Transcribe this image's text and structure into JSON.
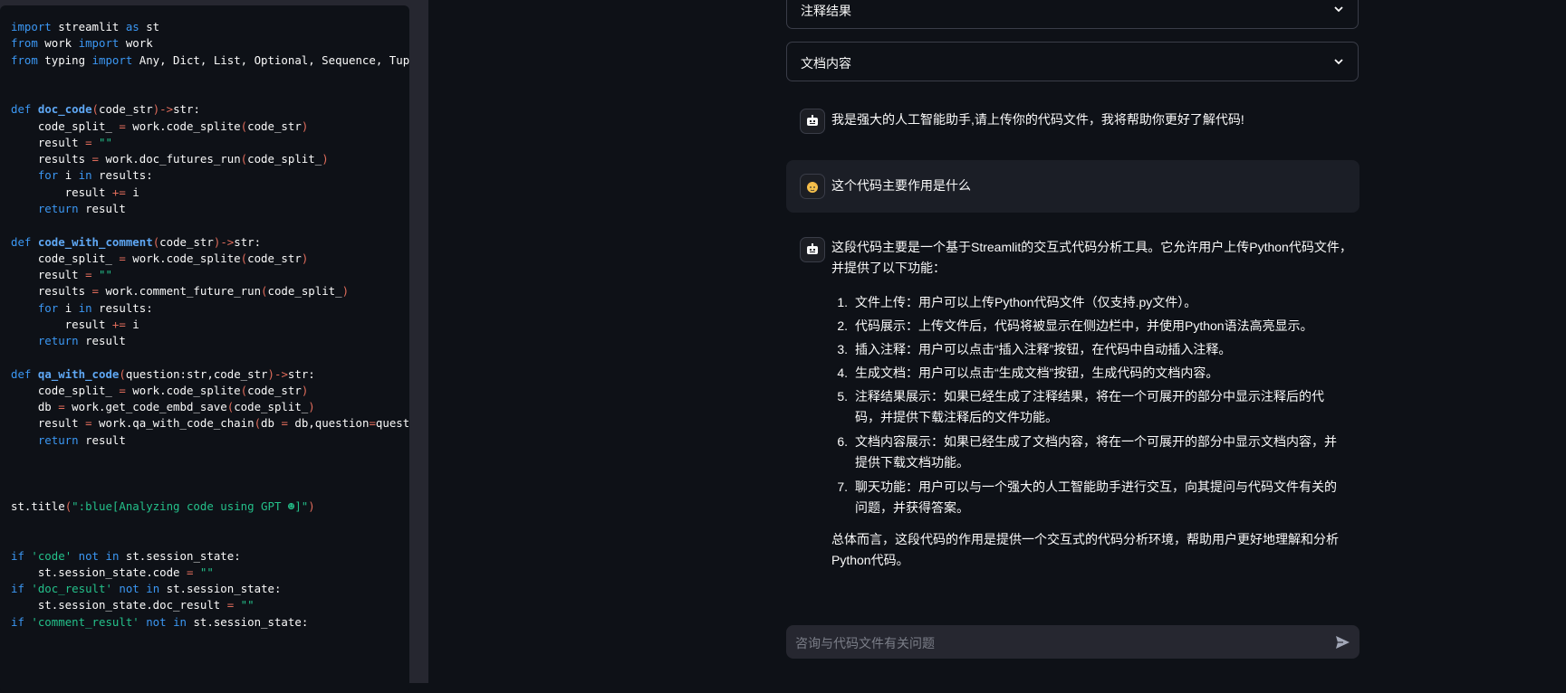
{
  "colors": {
    "app_bg": "#0e1117",
    "sidebar_bg": "#262730",
    "keyword": "#3b97f3",
    "string": "#24c08a",
    "operator": "#e06c5b",
    "border": "#3a3d48"
  },
  "sidebar": {
    "code": {
      "language": "python",
      "lines": [
        "import streamlit as st",
        "from work import work",
        "from typing import Any, Dict, List, Optional, Sequence, Tup",
        "",
        "",
        "def doc_code(code_str)->str:",
        "    code_split_ = work.code_splite(code_str)",
        "    result = \"\"",
        "    results = work.doc_futures_run(code_split_)",
        "    for i in results:",
        "        result += i",
        "    return result",
        "",
        "def code_with_comment(code_str)->str:",
        "    code_split_ = work.code_splite(code_str)",
        "    result = \"\"",
        "    results = work.comment_future_run(code_split_)",
        "    for i in results:",
        "        result += i",
        "    return result",
        "",
        "def qa_with_code(question:str,code_str)->str:",
        "    code_split_ = work.code_splite(code_str)",
        "    db = work.get_code_embd_save(code_split_)",
        "    result = work.qa_with_code_chain(db = db,question=quest",
        "    return result",
        "",
        "",
        "",
        "st.title(\":blue[Analyzing code using GPT ☻]\")",
        "",
        "",
        "if 'code' not in st.session_state:",
        "    st.session_state.code = \"\"",
        "if 'doc_result' not in st.session_state:",
        "    st.session_state.doc_result = \"\"",
        "if 'comment_result' not in st.session_state:"
      ]
    }
  },
  "main": {
    "expanders": [
      {
        "label": "注释结果",
        "icon": "chevron-down-icon"
      },
      {
        "label": "文档内容",
        "icon": "chevron-down-icon"
      }
    ],
    "messages": [
      {
        "role": "assistant",
        "avatar_icon": "robot-icon",
        "text": "我是强大的人工智能助手,请上传你的代码文件，我将帮助你更好了解代码!"
      },
      {
        "role": "user",
        "avatar_icon": "user-face-icon",
        "text": "这个代码主要作用是什么"
      },
      {
        "role": "assistant",
        "avatar_icon": "robot-icon",
        "intro": "这段代码主要是一个基于Streamlit的交互式代码分析工具。它允许用户上传Python代码文件，并提供了以下功能：",
        "items": [
          "文件上传：用户可以上传Python代码文件（仅支持.py文件）。",
          "代码展示：上传文件后，代码将被显示在侧边栏中，并使用Python语法高亮显示。",
          "插入注释：用户可以点击“插入注释”按钮，在代码中自动插入注释。",
          "生成文档：用户可以点击“生成文档”按钮，生成代码的文档内容。",
          "注释结果展示：如果已经生成了注释结果，将在一个可展开的部分中显示注释后的代码，并提供下载注释后的文件功能。",
          "文档内容展示：如果已经生成了文档内容，将在一个可展开的部分中显示文档内容，并提供下载文档功能。",
          "聊天功能：用户可以与一个强大的人工智能助手进行交互，向其提问与代码文件有关的问题，并获得答案。"
        ],
        "summary": "总体而言，这段代码的作用是提供一个交互式的代码分析环境，帮助用户更好地理解和分析Python代码。"
      }
    ],
    "chat_input": {
      "placeholder": "咨询与代码文件有关问题",
      "value": "",
      "send_icon": "send-icon"
    }
  }
}
